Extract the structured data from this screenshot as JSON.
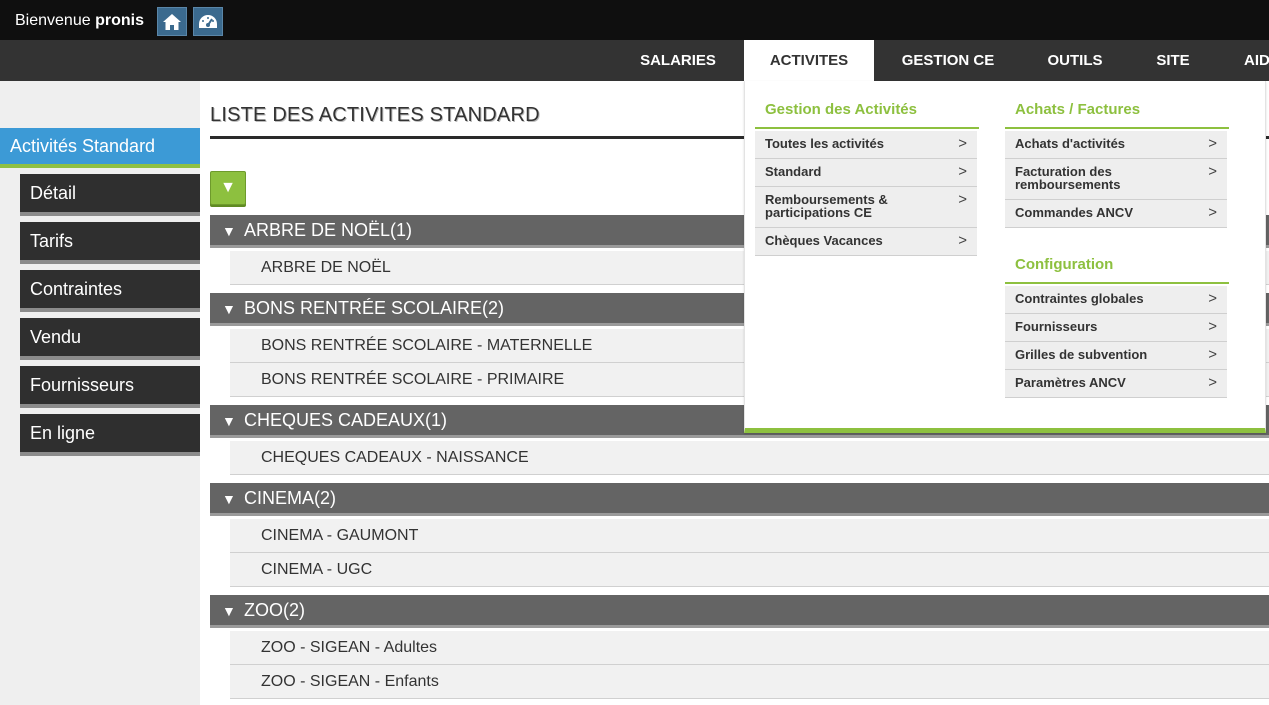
{
  "topbar": {
    "welcome_prefix": "Bienvenue",
    "username": "pronis",
    "icons": [
      "home-icon",
      "dashboard-icon"
    ]
  },
  "nav": {
    "items": [
      "SALARIES",
      "ACTIVITES",
      "GESTION CE",
      "OUTILS",
      "SITE",
      "AID"
    ],
    "active": "ACTIVITES"
  },
  "sidebar": {
    "heading": "Activités Standard",
    "items": [
      "Détail",
      "Tarifs",
      "Contraintes",
      "Vendu",
      "Fournisseurs",
      "En ligne"
    ]
  },
  "content": {
    "title": "LISTE DES ACTIVITES STANDARD",
    "toggle_glyph": "▼",
    "categories": [
      {
        "label": "ARBRE DE NOËL(1)",
        "items": [
          "ARBRE DE NOËL"
        ]
      },
      {
        "label": "BONS RENTRÉE SCOLAIRE(2)",
        "items": [
          "BONS RENTRÉE SCOLAIRE - MATERNELLE",
          "BONS RENTRÉE SCOLAIRE - PRIMAIRE"
        ]
      },
      {
        "label": "CHEQUES CADEAUX(1)",
        "items": [
          "CHEQUES CADEAUX - NAISSANCE"
        ]
      },
      {
        "label": "CINEMA(2)",
        "items": [
          "CINEMA - GAUMONT",
          "CINEMA - UGC"
        ]
      },
      {
        "label": "ZOO(2)",
        "items": [
          "ZOO - SIGEAN - Adultes",
          "ZOO - SIGEAN - Enfants"
        ]
      }
    ]
  },
  "dropdown": {
    "arrow": ">",
    "gestion": {
      "heading": "Gestion des Activités",
      "items": [
        "Toutes les activités",
        "Standard",
        "Remboursements & participations CE",
        "Chèques Vacances"
      ]
    },
    "achats": {
      "heading": "Achats / Factures",
      "items": [
        "Achats d'activités",
        "Facturation des remboursements",
        "Commandes ANCV"
      ]
    },
    "config": {
      "heading": "Configuration",
      "items": [
        "Contraintes globales",
        "Fournisseurs",
        "Grilles de subvention",
        "Paramètres ANCV"
      ]
    }
  },
  "colors": {
    "accent_green": "#8dc03f",
    "sidebar_blue": "#3c9ad6",
    "nav_dark": "#333333",
    "topbar": "#0f0f0f"
  }
}
